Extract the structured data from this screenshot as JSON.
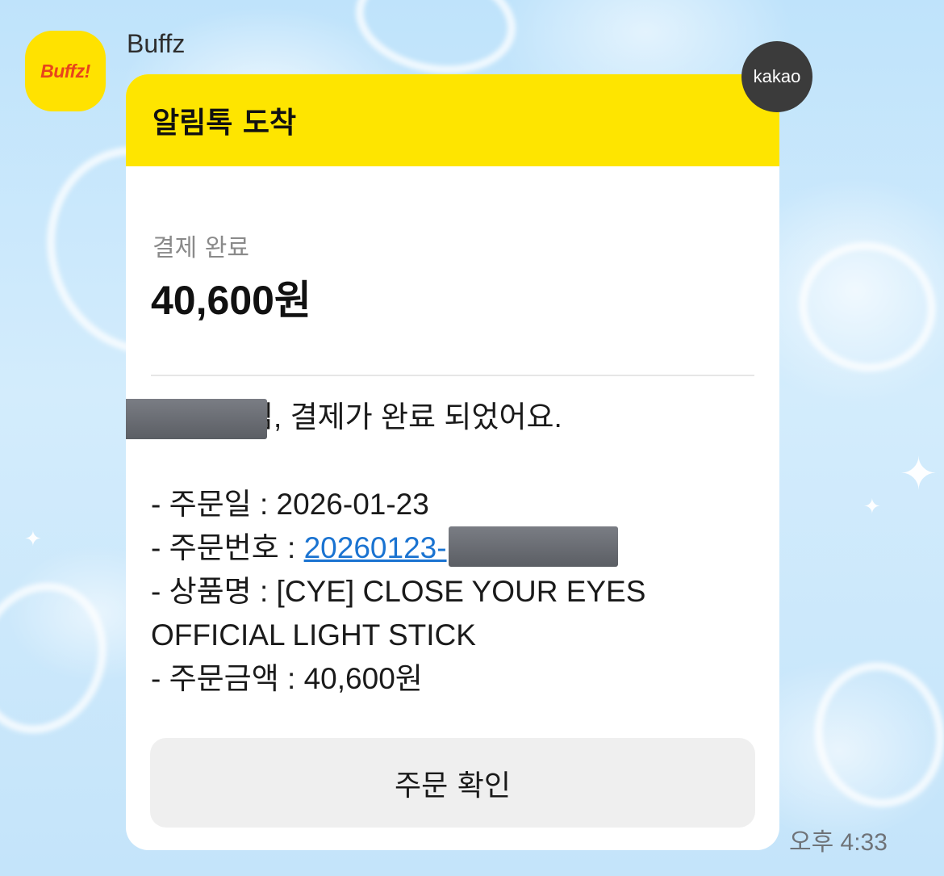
{
  "sender": {
    "name": "Buffz",
    "avatar_text": "Buffz!"
  },
  "badge": {
    "label": "kakao"
  },
  "card": {
    "header_title": "알림톡 도착",
    "pay_label": "결제 완료",
    "pay_amount": "40,600원",
    "greeting_suffix": "님, 결제가 완료 되었어요.",
    "order_date_line": "- 주문일 : 2026-01-23",
    "order_number_prefix": "- 주문번호 : ",
    "order_number_link": "20260123-",
    "product_line_1": "- 상품명 : [CYE] CLOSE YOUR EYES",
    "product_line_2": "OFFICIAL LIGHT STICK",
    "order_amount_line": "- 주문금액 : 40,600원",
    "confirm_button": "주문 확인"
  },
  "timestamp": "오후 4:33",
  "colors": {
    "header_yellow": "#fee500",
    "link_blue": "#1a73d1",
    "avatar_text": "#e8441c",
    "badge_bg": "#3b3b3b"
  }
}
